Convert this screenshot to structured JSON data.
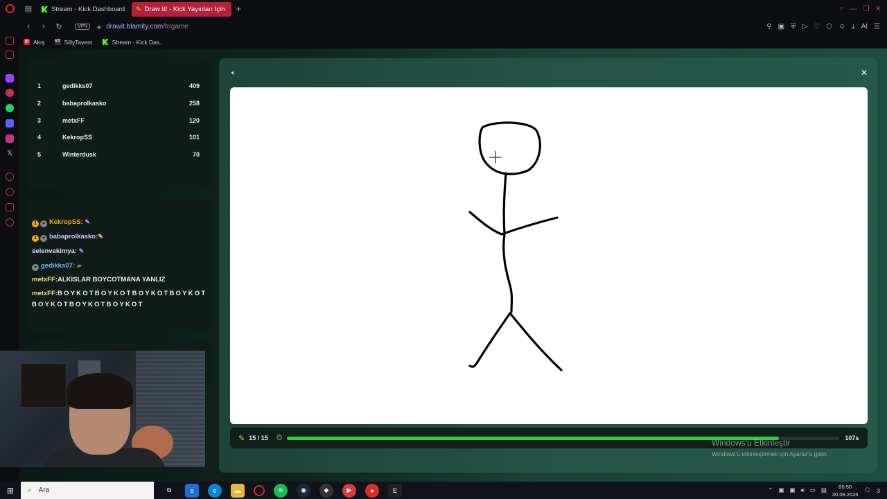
{
  "browser": {
    "tabs": [
      {
        "label": "Stream - Kick Dashboard"
      },
      {
        "label": "Draw It! - Kick Yayınları İçin"
      }
    ],
    "vpn_label": "VPN",
    "url_host": "drawit.blamity.com",
    "url_path": "/tr/game",
    "ai_label": "AI",
    "bookmarks": [
      {
        "label": "Akış"
      },
      {
        "label": "SillyTavern"
      },
      {
        "label": "Stream - Kick Das..."
      }
    ]
  },
  "leaderboard": [
    {
      "rank": "1",
      "name": "gedikks07",
      "score": "409"
    },
    {
      "rank": "2",
      "name": "babaprolkasko",
      "score": "258"
    },
    {
      "rank": "3",
      "name": "metxFF",
      "score": "120"
    },
    {
      "rank": "4",
      "name": "KekropSS",
      "score": "101"
    },
    {
      "rank": "5",
      "name": "Winterdusk",
      "score": "70"
    }
  ],
  "chat": {
    "messages": [
      {
        "user": "KekropSS",
        "text": ""
      },
      {
        "user": "babaprolkasko",
        "text": ""
      },
      {
        "user": "selenvekimya",
        "text": ""
      },
      {
        "user": "gedikks07",
        "text": ""
      },
      {
        "user": "metxFF",
        "text": "ALKISLAR BOYCOTMANA YANLIZ"
      },
      {
        "user": "metxFF",
        "text": "BOYKOTBOYKOTBOYKOTBOYKOT BOYKOTBOYKOTBOYKOT"
      }
    ]
  },
  "game": {
    "round_label": "15 / 15",
    "time_label": "107s",
    "progress": 0.89
  },
  "windows_activation": {
    "title": "Windows'u Etkinleştir",
    "subtitle": "Windows'u etkinleştirmek için Ayarlar'a gidin."
  },
  "taskbar": {
    "search_placeholder": "Ara",
    "time": "00:50",
    "date": "30.08.2026",
    "notification_count": "3"
  }
}
